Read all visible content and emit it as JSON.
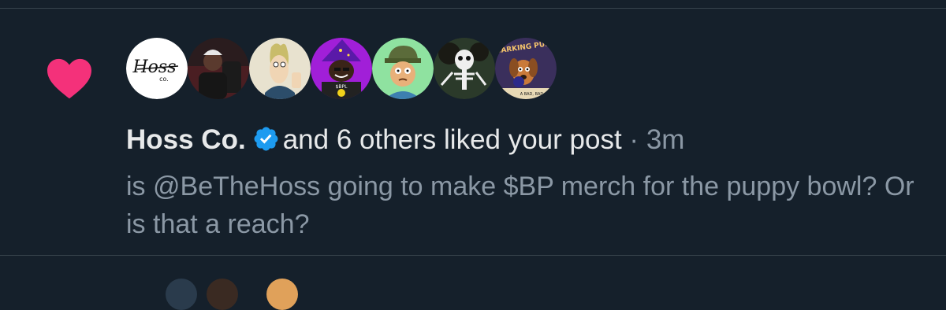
{
  "notification": {
    "icon": "heart-icon",
    "accent_color": "#f4317a",
    "avatars": [
      {
        "name": "hoss-co-avatar",
        "text_main": "Hoss",
        "text_sub": "co."
      },
      {
        "name": "red-chair-avatar"
      },
      {
        "name": "beavis-avatar"
      },
      {
        "name": "wizard-avatar",
        "text_main": "$BPL"
      },
      {
        "name": "green-hat-cartoon-avatar"
      },
      {
        "name": "skeleton-avatar"
      },
      {
        "name": "barking-puppy-avatar",
        "text_main": "BARKING PUPPY",
        "text_sub": "A BAD, BAD, D"
      }
    ],
    "user_name": "Hoss Co.",
    "verified_badge": "verified-badge-icon",
    "action_text": "and 6 others liked your post",
    "separator": "·",
    "time": "3m",
    "post_text": "is @BeTheHoss going to make $BP merch for the puppy bowl? Or is that a reach?"
  }
}
